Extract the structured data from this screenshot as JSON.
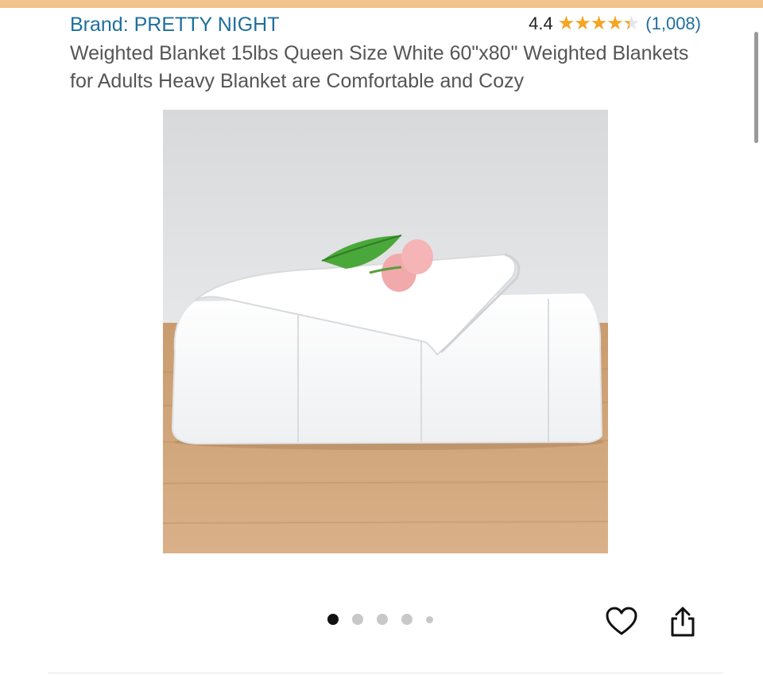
{
  "colors": {
    "top_strip": "#f2c48d",
    "link": "#1f6f9e",
    "star": "#f4a522",
    "title_text": "#555555"
  },
  "brand": {
    "label": "Brand: PRETTY NIGHT"
  },
  "rating": {
    "value": "4.4",
    "stars_out_of_5": 4.4,
    "count": "(1,008)"
  },
  "product": {
    "title": "Weighted Blanket 15lbs Queen Size White 60\"x80\" Weighted Blankets for Adults Heavy Blanket are Comfortable and Cozy"
  },
  "carousel": {
    "total_images": 5,
    "active_index": 0
  },
  "actions": {
    "favorite_icon": "heart-icon",
    "share_icon": "share-icon"
  }
}
